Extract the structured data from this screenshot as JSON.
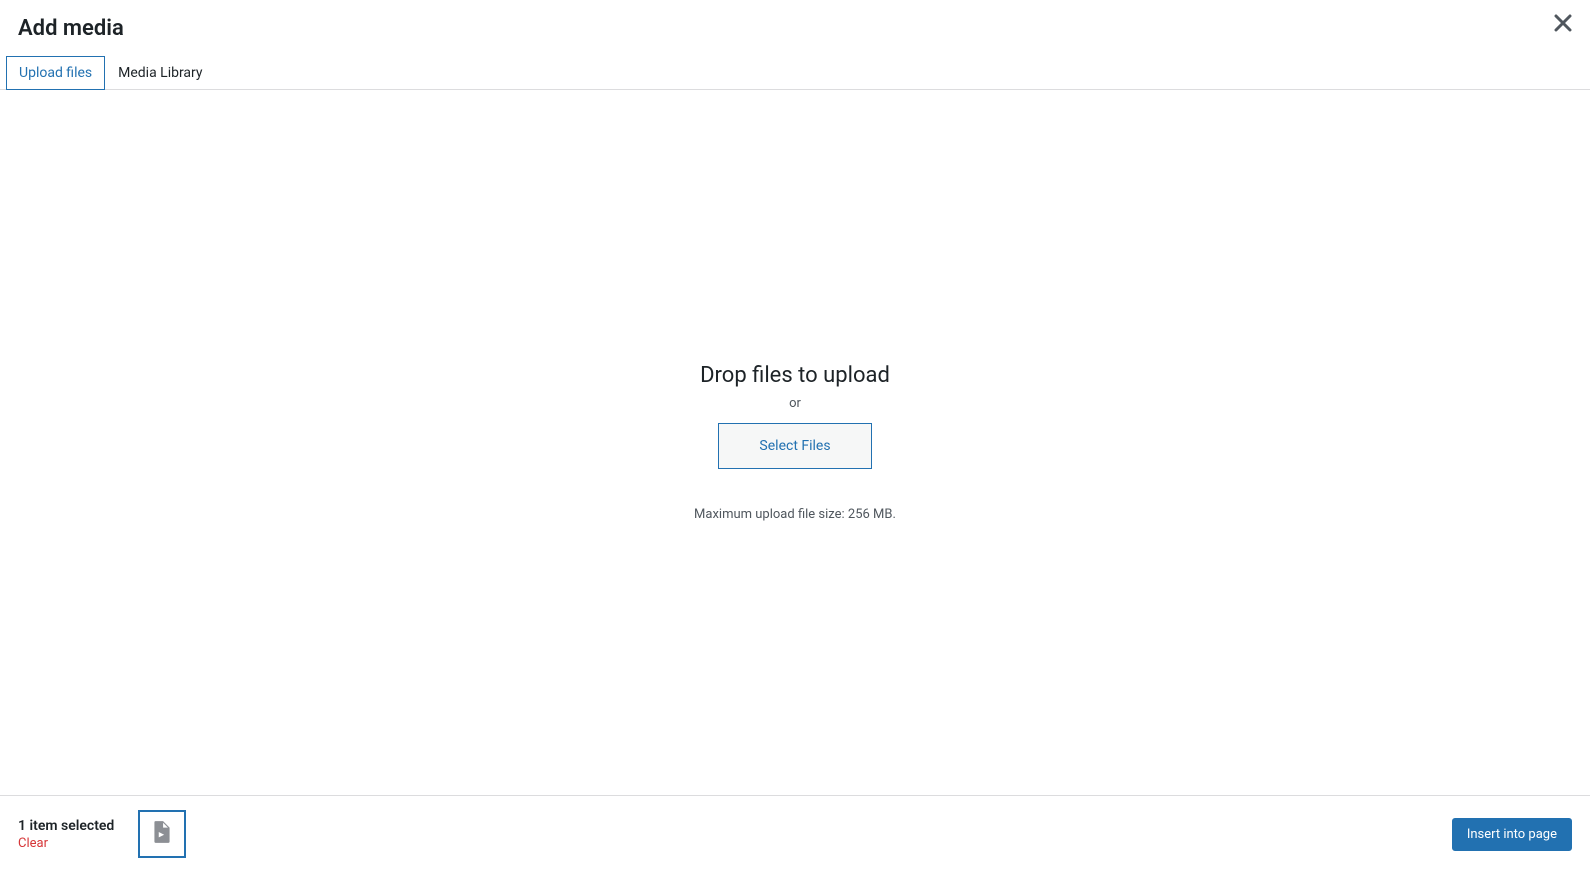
{
  "header": {
    "title": "Add media"
  },
  "tabs": {
    "upload_files": "Upload files",
    "media_library": "Media Library"
  },
  "upload": {
    "heading": "Drop files to upload",
    "or": "or",
    "select_files_label": "Select Files",
    "max_size_text": "Maximum upload file size: 256 MB."
  },
  "footer": {
    "selected_count": "1 item selected",
    "clear_label": "Clear",
    "insert_label": "Insert into page"
  }
}
